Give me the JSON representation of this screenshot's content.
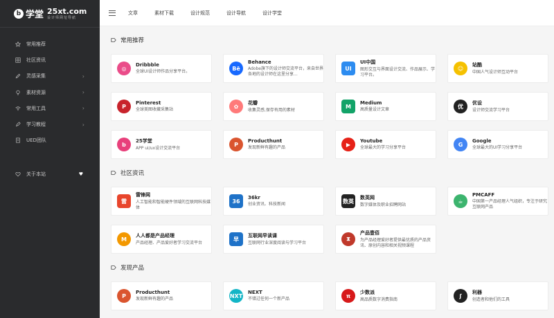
{
  "logo": {
    "mark": "b",
    "cn": "学堂",
    "en": "25xt.com",
    "sub": "设计师网址导航"
  },
  "sidebar": {
    "items": [
      {
        "label": "常用推荐",
        "icon": "star-icon",
        "caret": false
      },
      {
        "label": "社区资讯",
        "icon": "grid-icon",
        "caret": false
      },
      {
        "label": "灵感采集",
        "icon": "pencil-icon",
        "caret": true
      },
      {
        "label": "素材资源",
        "icon": "bulb-icon",
        "caret": true
      },
      {
        "label": "常用工具",
        "icon": "wifi-icon",
        "caret": true
      },
      {
        "label": "学习教程",
        "icon": "pen-icon",
        "caret": true
      },
      {
        "label": "UED团队",
        "icon": "doc-icon",
        "caret": false
      }
    ],
    "about": {
      "label": "关于本站",
      "icon": "heart-outline-icon"
    }
  },
  "topnav": [
    "文章",
    "素材下载",
    "设计规范",
    "设计导航",
    "设计学堂"
  ],
  "sections": [
    {
      "title": "常用推荐"
    },
    {
      "title": "社区资讯"
    },
    {
      "title": "发现产品"
    }
  ],
  "cards": [
    {
      "name": "Dribbble",
      "desc": "全球UI设计师作品分享平台。",
      "icon": "dribbble-icon",
      "glyph": "◎",
      "color": "#ea4c89"
    },
    {
      "name": "Behance",
      "desc": "Adobe旗下的设计师交流平台，来自世界各地的设计师在这里分享...",
      "icon": "behance-icon",
      "glyph": "Bē",
      "color": "#1769ff"
    },
    {
      "name": "UI中国",
      "desc": "图形交互与界面设计交流、作品展示、学习平台。",
      "icon": "ui-china-icon",
      "glyph": "UI",
      "color": "#2d8cf0"
    },
    {
      "name": "站酷",
      "desc": "中国人气设计师互动平台",
      "icon": "zcool-icon",
      "glyph": "☺",
      "color": "#f5c100"
    },
    {
      "name": "Pinterest",
      "desc": "全球美图收藏采集站",
      "icon": "pinterest-icon",
      "glyph": "P",
      "color": "#c8232c"
    },
    {
      "name": "花瓣",
      "desc": "收集灵感,保存有用的素材",
      "icon": "huaban-icon",
      "glyph": "✿",
      "color": "#ff7a7a"
    },
    {
      "name": "Medium",
      "desc": "高质量设计文章",
      "icon": "medium-icon",
      "glyph": "M",
      "color": "#12a368"
    },
    {
      "name": "优设",
      "desc": "设计师交流学习平台",
      "icon": "uisdc-icon",
      "glyph": "优",
      "color": "#222222"
    },
    {
      "name": "25学堂",
      "desc": "APP ui/ux设计交流平台",
      "icon": "25xt-icon",
      "glyph": "b",
      "color": "#e8407b"
    },
    {
      "name": "Producthunt",
      "desc": "发现新鲜有趣的产品",
      "icon": "producthunt-icon",
      "glyph": "P",
      "color": "#da552f"
    },
    {
      "name": "Youtube",
      "desc": "全球最大的学习分享平台",
      "icon": "youtube-icon",
      "glyph": "▶",
      "color": "#e62117"
    },
    {
      "name": "Google",
      "desc": "全球最大的UI学习分享平台",
      "icon": "google-icon",
      "glyph": "G",
      "color": "#4285f4"
    },
    {
      "name": "雷锋网",
      "desc": "人工智能和智能硬件领域的互联网科技媒体",
      "icon": "leiphone-icon",
      "glyph": "雷",
      "color": "#e8452c"
    },
    {
      "name": "36kr",
      "desc": "创业资讯、科技新闻",
      "icon": "36kr-icon",
      "glyph": "36",
      "color": "#1e72c8"
    },
    {
      "name": "数英网",
      "desc": "数字媒体及职业招聘网站",
      "icon": "digitaling-icon",
      "glyph": "数英",
      "color": "#222222"
    },
    {
      "name": "PMCAFF",
      "desc": "中国第一产品经理人气组织，专注于研究互联网产品",
      "icon": "pmcaff-icon",
      "glyph": "☕",
      "color": "#3cb46e"
    },
    {
      "name": "人人都是产品经理",
      "desc": "产品经理、产品爱好者学习交流平台",
      "icon": "woshipm-icon",
      "glyph": "M",
      "color": "#f39800"
    },
    {
      "name": "互联网早读课",
      "desc": "互联网行业深度阅读与学习平台",
      "icon": "zaodula-icon",
      "glyph": "早",
      "color": "#1e72c8"
    },
    {
      "name": "产品壹佰",
      "desc": "为产品经理爱好者提供最优质的产品资讯、原创内容和相关视频课程",
      "icon": "chanpin100-icon",
      "glyph": "⧗",
      "color": "#c0392b"
    },
    {
      "name": "Producthunt",
      "desc": "发现新鲜有趣的产品",
      "icon": "producthunt-icon",
      "glyph": "P",
      "color": "#da552f"
    },
    {
      "name": "NEXT",
      "desc": "不错过任何一个新产品",
      "icon": "next-icon",
      "glyph": "NXT",
      "color": "#13b5c6"
    },
    {
      "name": "少数派",
      "desc": "高品质数字消费指南",
      "icon": "sspai-icon",
      "glyph": "π",
      "color": "#d7191a"
    },
    {
      "name": "利器",
      "desc": "创造者和他们的工具",
      "icon": "liqi-icon",
      "glyph": "ʃ",
      "color": "#222222"
    }
  ]
}
